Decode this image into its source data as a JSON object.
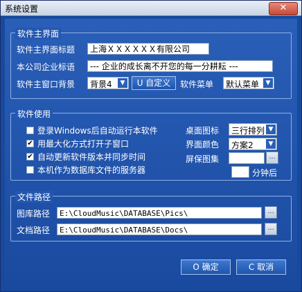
{
  "window": {
    "title": "系统设置",
    "close_glyph": "✕"
  },
  "main_group": {
    "label": "软件主界面",
    "title_label": "软件主界面标题",
    "title_value": "上海ＸＸＸＸＸＸ有限公司",
    "slogan_label": "本公司企业标语",
    "slogan_value": "--- 企业的成长离不开您的每一分耕耘 ---",
    "bg_label": "软件主窗口背景",
    "bg_value": "背景4",
    "custom_button": "U 自定义",
    "menu_label": "软件菜单",
    "menu_value": "默认菜单"
  },
  "usage_group": {
    "label": "软件使用",
    "options": [
      {
        "label": "登录Windows后自动运行本软件",
        "checked": false
      },
      {
        "label": "用最大化方式打开子窗口",
        "checked": true
      },
      {
        "label": "自动更新软件版本并同步时间",
        "checked": true
      },
      {
        "label": "本机作为数据库文件的服务器",
        "checked": false
      }
    ],
    "check_glyph": "✔",
    "desktop_icon_label": "桌面图标",
    "desktop_icon_value": "三行排列",
    "color_label": "界面颜色",
    "color_value": "方案2",
    "screensaver_label": "屏保图集",
    "screensaver_value": "",
    "minutes_value": "",
    "minutes_label": "分钟后"
  },
  "path_group": {
    "label": "文件路径",
    "pics_label": "图库路径",
    "pics_value": "E:\\CloudMusic\\DATABASE\\Pics\\",
    "docs_label": "文档路径",
    "docs_value": "E:\\CloudMusic\\DATABASE\\Docs\\",
    "browse_glyph": "..."
  },
  "buttons": {
    "ok": "O 确定",
    "cancel": "C 取消"
  },
  "icons": {
    "dropdown": "▼"
  }
}
